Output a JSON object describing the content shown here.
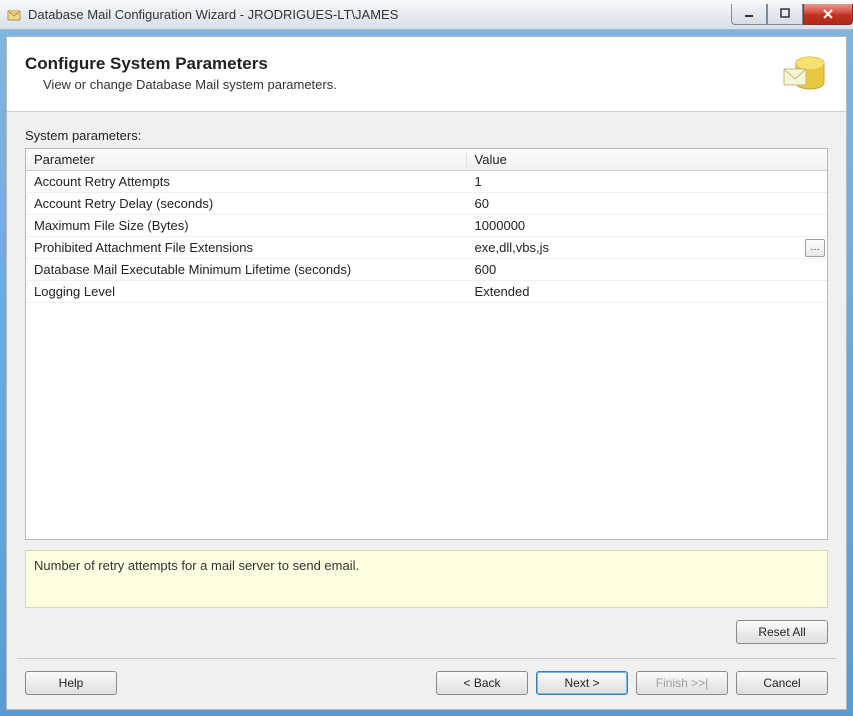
{
  "window": {
    "title": "Database Mail Configuration Wizard - JRODRIGUES-LT\\JAMES"
  },
  "header": {
    "title": "Configure System Parameters",
    "subtitle": "View or change Database Mail system parameters."
  },
  "content": {
    "table_label": "System parameters:",
    "columns": {
      "param": "Parameter",
      "value": "Value"
    },
    "rows": [
      {
        "param": "Account Retry Attempts",
        "value": "1",
        "ellipsis": false
      },
      {
        "param": "Account Retry Delay (seconds)",
        "value": "60",
        "ellipsis": false
      },
      {
        "param": "Maximum File Size (Bytes)",
        "value": "1000000",
        "ellipsis": false
      },
      {
        "param": "Prohibited Attachment File Extensions",
        "value": "exe,dll,vbs,js",
        "ellipsis": true
      },
      {
        "param": "Database Mail Executable Minimum Lifetime (seconds)",
        "value": "600",
        "ellipsis": false
      },
      {
        "param": "Logging Level",
        "value": "Extended",
        "ellipsis": false
      }
    ],
    "hint": "Number of retry attempts for a mail server to send email.",
    "reset_label": "Reset All"
  },
  "footer": {
    "help": "Help",
    "back": "< Back",
    "next": "Next >",
    "finish": "Finish >>|",
    "cancel": "Cancel"
  }
}
